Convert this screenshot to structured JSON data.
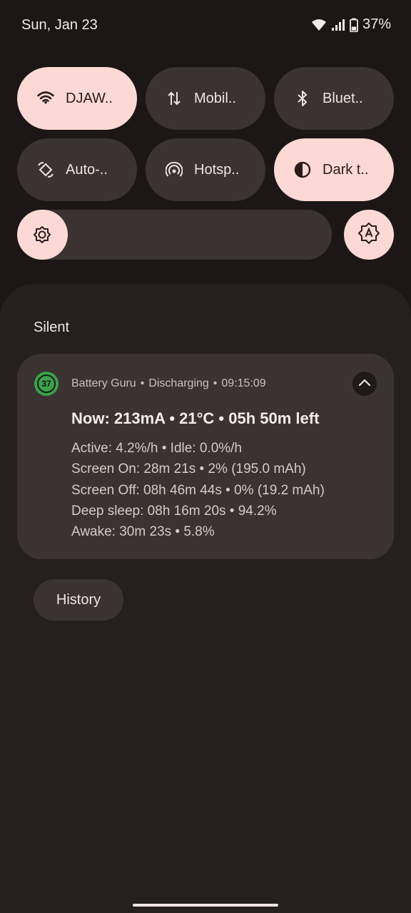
{
  "status_bar": {
    "date": "Sun, Jan 23",
    "battery": "37%",
    "icons": [
      "wifi-icon",
      "cellular-signal-icon",
      "battery-icon"
    ]
  },
  "quick_tiles": [
    {
      "label": "DJAW..",
      "icon": "wifi-icon",
      "on": true
    },
    {
      "label": "Mobil..",
      "icon": "mobile-data-icon",
      "on": false
    },
    {
      "label": "Bluet..",
      "icon": "bluetooth-icon",
      "on": false
    },
    {
      "label": "Auto-..",
      "icon": "auto-rotate-icon",
      "on": false
    },
    {
      "label": "Hotsp..",
      "icon": "hotspot-icon",
      "on": false
    },
    {
      "label": "Dark t..",
      "icon": "dark-theme-icon",
      "on": true
    }
  ],
  "brightness": {
    "level": 0.16,
    "icon": "brightness-icon",
    "auto_icon": "auto-brightness-icon"
  },
  "shade": {
    "section_title": "Silent",
    "notification": {
      "app_icon_text": "37",
      "app_name": "Battery Guru",
      "state": "Discharging",
      "time": "09:15:09",
      "separator": "•",
      "title": "Now: 213mA • 21°C • 05h 50m left",
      "lines": [
        "Active: 4.2%/h • Idle: 0.0%/h",
        "Screen On: 28m 21s • 2% (195.0 mAh)",
        "Screen Off: 08h 46m 44s • 0% (19.2 mAh)",
        "Deep sleep: 08h 16m 20s • 94.2%",
        "Awake: 30m 23s • 5.8%"
      ]
    },
    "history_button": "History"
  },
  "colors": {
    "background": "#1c1616",
    "tile_off": "#3a3332",
    "tile_on": "#fdd9d5",
    "app_icon": "#3aa34a"
  }
}
